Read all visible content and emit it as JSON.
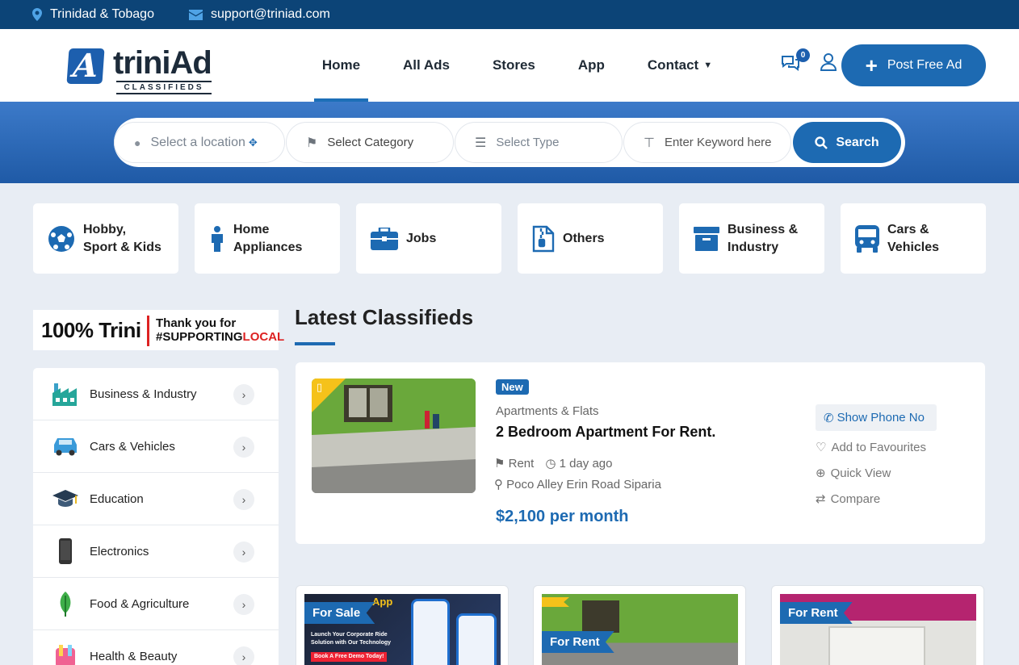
{
  "topbar": {
    "location": "Trinidad & Tobago",
    "email": "support@triniad.com"
  },
  "brand": {
    "mark": "A",
    "name": "triniAd",
    "tagline": "CLASSIFIEDS"
  },
  "nav": [
    "Home",
    "All Ads",
    "Stores",
    "App",
    "Contact"
  ],
  "header": {
    "message_count": "0",
    "post_button": "Post Free Ad"
  },
  "search": {
    "location_placeholder": "Select a location",
    "category_placeholder": "Select Category",
    "type_placeholder": "Select Type",
    "keyword_placeholder": "Enter Keyword here",
    "button": "Search"
  },
  "categories": [
    {
      "line1": "Hobby,",
      "line2": "Sport & Kids",
      "icon": "soccer-ball-icon"
    },
    {
      "line1": "Home",
      "line2": "Appliances",
      "icon": "person-icon"
    },
    {
      "line1": "Jobs",
      "line2": "",
      "icon": "briefcase-icon"
    },
    {
      "line1": "Others",
      "line2": "",
      "icon": "zip-file-icon"
    },
    {
      "line1": "Business &",
      "line2": "Industry",
      "icon": "archive-box-icon"
    },
    {
      "line1": "Cars &",
      "line2": "Vehicles",
      "icon": "bus-icon"
    }
  ],
  "banner": {
    "left": "100% Trini",
    "right1": "Thank you for",
    "right2a": "#SUPPORTING",
    "right2b": "LOCAL"
  },
  "sidebar": [
    "Business & Industry",
    "Cars & Vehicles",
    "Education",
    "Electronics",
    "Food & Agriculture",
    "Health & Beauty"
  ],
  "latest": {
    "title": "Latest Classifieds",
    "featured": {
      "badge": "New",
      "category": "Apartments & Flats",
      "title": "2 Bedroom Apartment For Rent.",
      "type": "Rent",
      "time": "1 day ago",
      "location": "Poco Alley Erin Road Siparia",
      "price": "$2,100 per month",
      "show_phone": "Show Phone No",
      "favourite": "Add to Favourites",
      "quick_view": "Quick View",
      "compare": "Compare"
    }
  },
  "cards": [
    {
      "tag": "For Sale",
      "promo_word": "App",
      "promo1": "Launch Your Corporate Ride",
      "promo2": "Solution with Our Technology",
      "promo3": "Book A Free Demo Today!"
    },
    {
      "tag": "For Rent"
    },
    {
      "tag": "For Rent"
    }
  ],
  "colors": {
    "primary": "#1d6ab2",
    "topbar": "#0c4477",
    "accent_yellow": "#f5c21a"
  }
}
